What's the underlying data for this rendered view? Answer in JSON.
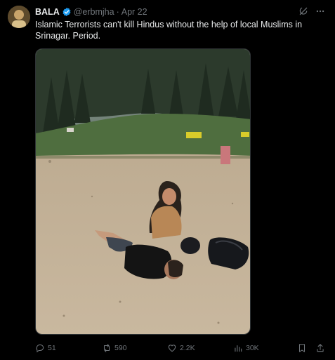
{
  "tweet": {
    "display_name": "BALA",
    "handle": "@erbmjha",
    "separator": "·",
    "date": "Apr 22",
    "text": "Islamic Terrorists can't kill Hindus without the help of local Muslims in Srinagar. Period.",
    "verified_color": "#1d9bf0"
  },
  "metrics": {
    "replies": "51",
    "reposts": "590",
    "likes": "2.2K",
    "views": "30K"
  },
  "icons": {
    "grok": "grok-icon",
    "more": "more-icon",
    "reply": "reply-icon",
    "repost": "repost-icon",
    "like": "like-icon",
    "views": "views-icon",
    "bookmark": "bookmark-icon",
    "share": "share-icon"
  },
  "colors": {
    "background": "#000000",
    "text": "#e7e9ea",
    "muted": "#71767b"
  }
}
